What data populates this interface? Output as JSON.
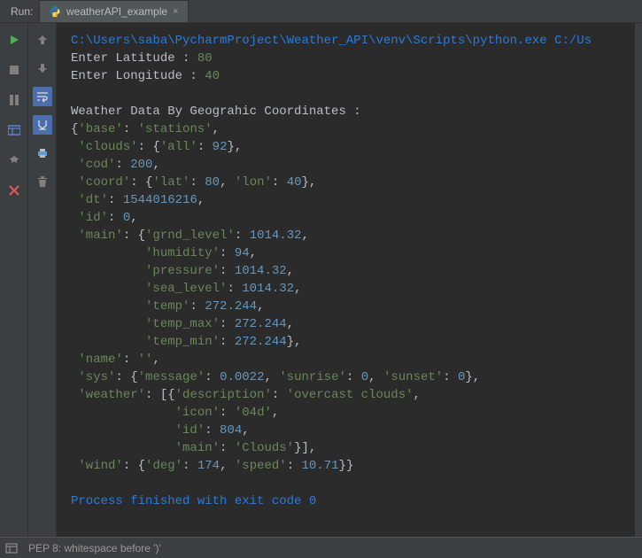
{
  "header": {
    "run_label": "Run:",
    "tab_title": "weatherAPI_example",
    "tab_close": "×"
  },
  "console": {
    "exec_path": "C:\\Users\\saba\\PycharmProject\\Weather_API\\venv\\Scripts\\python.exe C:/Us",
    "prompt_lat_label": "Enter Latitude : ",
    "prompt_lat_val": "80",
    "prompt_lon_label": "Enter Longitude : ",
    "prompt_lon_val": "40",
    "header_line": "Weather Data By Geograhic Coordinates :",
    "l1a": "{",
    "l1b": "'base'",
    "l1c": ": ",
    "l1d": "'stations'",
    "l1e": ",",
    "l2a": " ",
    "l2b": "'clouds'",
    "l2c": ": {",
    "l2d": "'all'",
    "l2e": ": ",
    "l2f": "92",
    "l2g": "},",
    "l3a": " ",
    "l3b": "'cod'",
    "l3c": ": ",
    "l3d": "200",
    "l3e": ",",
    "l4a": " ",
    "l4b": "'coord'",
    "l4c": ": {",
    "l4d": "'lat'",
    "l4e": ": ",
    "l4f": "80",
    "l4g": ", ",
    "l4h": "'lon'",
    "l4i": ": ",
    "l4j": "40",
    "l4k": "},",
    "l5a": " ",
    "l5b": "'dt'",
    "l5c": ": ",
    "l5d": "1544016216",
    "l5e": ",",
    "l6a": " ",
    "l6b": "'id'",
    "l6c": ": ",
    "l6d": "0",
    "l6e": ",",
    "l7a": " ",
    "l7b": "'main'",
    "l7c": ": {",
    "l7d": "'grnd_level'",
    "l7e": ": ",
    "l7f": "1014.32",
    "l7g": ",",
    "l8a": "          ",
    "l8b": "'humidity'",
    "l8c": ": ",
    "l8d": "94",
    "l8e": ",",
    "l9a": "          ",
    "l9b": "'pressure'",
    "l9c": ": ",
    "l9d": "1014.32",
    "l9e": ",",
    "l10a": "          ",
    "l10b": "'sea_level'",
    "l10c": ": ",
    "l10d": "1014.32",
    "l10e": ",",
    "l11a": "          ",
    "l11b": "'temp'",
    "l11c": ": ",
    "l11d": "272.244",
    "l11e": ",",
    "l12a": "          ",
    "l12b": "'temp_max'",
    "l12c": ": ",
    "l12d": "272.244",
    "l12e": ",",
    "l13a": "          ",
    "l13b": "'temp_min'",
    "l13c": ": ",
    "l13d": "272.244",
    "l13e": "},",
    "l14a": " ",
    "l14b": "'name'",
    "l14c": ": ",
    "l14d": "''",
    "l14e": ",",
    "l15a": " ",
    "l15b": "'sys'",
    "l15c": ": {",
    "l15d": "'message'",
    "l15e": ": ",
    "l15f": "0.0022",
    "l15g": ", ",
    "l15h": "'sunrise'",
    "l15i": ": ",
    "l15j": "0",
    "l15k": ", ",
    "l15l": "'sunset'",
    "l15m": ": ",
    "l15n": "0",
    "l15o": "},",
    "l16a": " ",
    "l16b": "'weather'",
    "l16c": ": [{",
    "l16d": "'description'",
    "l16e": ": ",
    "l16f": "'overcast clouds'",
    "l16g": ",",
    "l17a": "              ",
    "l17b": "'icon'",
    "l17c": ": ",
    "l17d": "'04d'",
    "l17e": ",",
    "l18a": "              ",
    "l18b": "'id'",
    "l18c": ": ",
    "l18d": "804",
    "l18e": ",",
    "l19a": "              ",
    "l19b": "'main'",
    "l19c": ": ",
    "l19d": "'Clouds'",
    "l19e": "}],",
    "l20a": " ",
    "l20b": "'wind'",
    "l20c": ": {",
    "l20d": "'deg'",
    "l20e": ": ",
    "l20f": "174",
    "l20g": ", ",
    "l20h": "'speed'",
    "l20i": ": ",
    "l20j": "10.71",
    "l20k": "}}",
    "finish": "Process finished with exit code 0"
  },
  "status": {
    "text": "PEP 8: whitespace before ')'"
  }
}
